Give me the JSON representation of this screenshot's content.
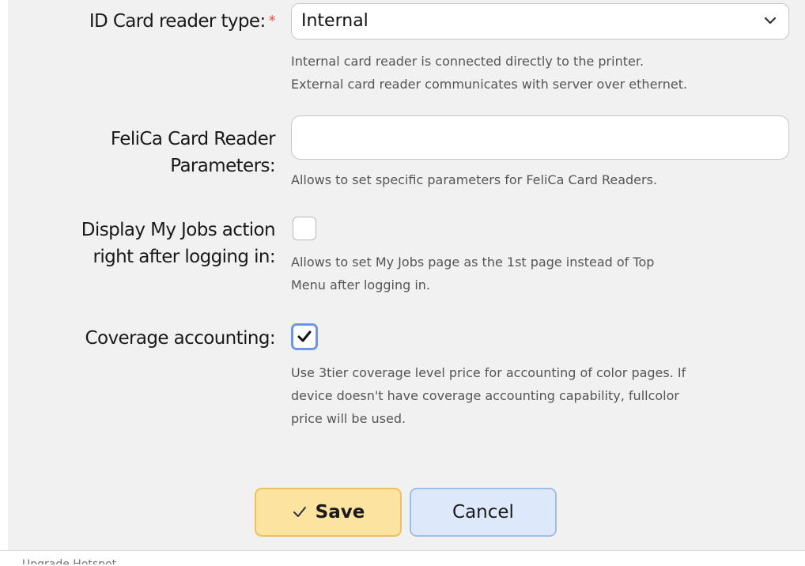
{
  "form": {
    "reader_type": {
      "label": "ID Card reader type:",
      "required_mark": "*",
      "value": "Internal",
      "hint_lines": [
        "Internal card reader is connected directly to the printer.",
        "External card reader communicates with server over ethernet."
      ]
    },
    "felica": {
      "label_line1": "FeliCa Card Reader",
      "label_line2": "Parameters:",
      "value": "",
      "hint": "Allows to set specific parameters for FeliCa Card Readers."
    },
    "my_jobs": {
      "label_line1": "Display My Jobs action",
      "label_line2": "right after logging in:",
      "checked": false,
      "hint_lines": [
        "Allows to set My Jobs page as the 1st page instead of Top",
        "Menu after logging in."
      ]
    },
    "coverage": {
      "label": "Coverage accounting:",
      "checked": true,
      "hint_lines": [
        "Use 3tier coverage level price for accounting of color pages. If",
        "device doesn't have coverage accounting capability, fullcolor",
        "price will be used."
      ]
    }
  },
  "buttons": {
    "save_label": "Save",
    "cancel_label": "Cancel"
  },
  "footer": {
    "fragment": "Upgrade Hotspot"
  },
  "colors": {
    "panel_bg": "#f1f1f1",
    "required": "#d9534f",
    "save_bg": "#fde3a0",
    "cancel_bg": "#dde9fb",
    "checkbox_focus": "#6f95e8"
  },
  "icons": {
    "select_arrow": "chevron-down-icon",
    "checkbox_mark": "check-icon",
    "save_icon": "check-icon"
  }
}
